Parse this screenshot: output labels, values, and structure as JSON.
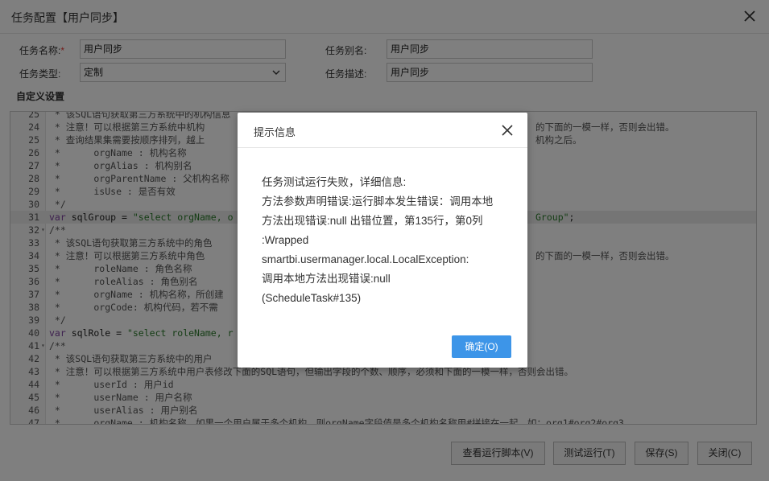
{
  "dialog": {
    "title": "任务配置【用户同步】"
  },
  "form": {
    "task_name": {
      "label": "任务名称:",
      "required_mark": "*",
      "value": "用户同步"
    },
    "task_alias": {
      "label": "任务别名:",
      "value": "用户同步"
    },
    "task_type": {
      "label": "任务类型:",
      "value": "定制"
    },
    "task_desc": {
      "label": "任务描述:",
      "value": "用户同步"
    }
  },
  "custom_section_title": "自定义设置",
  "editor": {
    "lines": [
      {
        "num": "25",
        "fold": "",
        "kind": "comment",
        "text": " * 该SQL语句获取第三方系统中的机构信息"
      },
      {
        "num": "24",
        "fold": "",
        "kind": "comment",
        "text": " * 注意！可以根据第三方系统中机构",
        "tail": "的下面的一模一样，否则会出错。"
      },
      {
        "num": "25",
        "fold": "",
        "kind": "comment",
        "text": " * 查询结果集需要按顺序排列，越上",
        "tail": "机构之后。"
      },
      {
        "num": "26",
        "fold": "",
        "kind": "comment",
        "text": " *      orgName : 机构名称"
      },
      {
        "num": "27",
        "fold": "",
        "kind": "comment",
        "text": " *      orgAlias : 机构别名"
      },
      {
        "num": "28",
        "fold": "",
        "kind": "comment",
        "text": " *      orgParentName : 父机构名称"
      },
      {
        "num": "29",
        "fold": "",
        "kind": "comment",
        "text": " *      isUse : 是否有效"
      },
      {
        "num": "30",
        "fold": "",
        "kind": "comment",
        "text": " */"
      },
      {
        "num": "31",
        "fold": "",
        "kind": "code",
        "kw": "var",
        "pln": " sqlGroup = ",
        "str": "\"select orgName, o",
        "tail_str": "Group\"",
        "tail_pln": ";",
        "active": true
      },
      {
        "num": "32",
        "fold": "▾",
        "kind": "comment",
        "text": "/**"
      },
      {
        "num": "33",
        "fold": "",
        "kind": "comment",
        "text": " * 该SQL语句获取第三方系统中的角色"
      },
      {
        "num": "34",
        "fold": "",
        "kind": "comment",
        "text": " * 注意！可以根据第三方系统中角色",
        "tail": "的下面的一模一样，否则会出错。"
      },
      {
        "num": "35",
        "fold": "",
        "kind": "comment",
        "text": " *      roleName : 角色名称"
      },
      {
        "num": "36",
        "fold": "",
        "kind": "comment",
        "text": " *      roleAlias : 角色别名"
      },
      {
        "num": "37",
        "fold": "",
        "kind": "comment",
        "text": " *      orgName : 机构名称，所创建"
      },
      {
        "num": "38",
        "fold": "",
        "kind": "comment",
        "text": " *      orgCode: 机构代码，若不需"
      },
      {
        "num": "39",
        "fold": "",
        "kind": "comment",
        "text": " */"
      },
      {
        "num": "40",
        "fold": "",
        "kind": "code",
        "kw": "var",
        "pln": " sqlRole = ",
        "str": "\"select roleName, r"
      },
      {
        "num": "41",
        "fold": "▾",
        "kind": "comment",
        "text": "/**"
      },
      {
        "num": "42",
        "fold": "",
        "kind": "comment",
        "text": " * 该SQL语句获取第三方系统中的用户"
      },
      {
        "num": "43",
        "fold": "",
        "kind": "comment",
        "text": " * 注意！可以根据第三方系统中用户表修改下面的SQL语句，但输出字段的个数、顺序，必须和下面的一模一样，否则会出错。"
      },
      {
        "num": "44",
        "fold": "",
        "kind": "comment",
        "text": " *      userId : 用户id"
      },
      {
        "num": "45",
        "fold": "",
        "kind": "comment",
        "text": " *      userName : 用户名称"
      },
      {
        "num": "46",
        "fold": "",
        "kind": "comment",
        "text": " *      userAlias : 用户别名"
      },
      {
        "num": "47",
        "fold": "",
        "kind": "comment",
        "text": " *      orgName : 机构名称，如果一个用户属于多个机构，则orgName字段值是多个机构名称用#拼接在一起，如：org1#org2#org3"
      }
    ]
  },
  "footer": {
    "view_script": "查看运行脚本(V)",
    "test_run": "测试运行(T)",
    "save": "保存(S)",
    "close": "关闭(C)"
  },
  "modal": {
    "title": "提示信息",
    "message_lines": [
      "任务测试运行失败，详细信息:",
      "方法参数声明错误:运行脚本发生错误：调用本地",
      "方法出现错误:null 出错位置，第135行，第0列",
      ":Wrapped",
      "smartbi.usermanager.local.LocalException:",
      "调用本地方法出现错误:null",
      "(ScheduleTask#135)"
    ],
    "ok_label": "确定(O)"
  },
  "colors": {
    "primary_button": "#3d95e8",
    "required_mark": "#e53935",
    "overlay": "rgba(0,0,0,0.5)"
  }
}
